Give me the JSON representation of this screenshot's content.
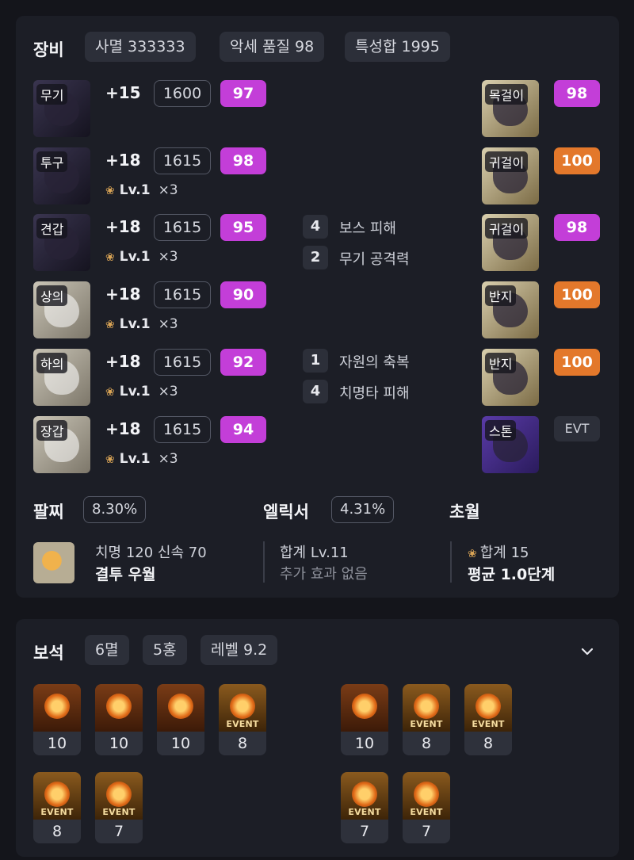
{
  "equipment": {
    "title": "장비",
    "chips": [
      "사멸 333333",
      "악세 품질 98",
      "특성합 1995"
    ],
    "items": [
      {
        "slot": "무기",
        "upgrade": "+15",
        "item_level": "1600",
        "quality": "97",
        "quality_color": "#c33ed8",
        "elixir": null
      },
      {
        "slot": "투구",
        "upgrade": "+18",
        "item_level": "1615",
        "quality": "98",
        "quality_color": "#c33ed8",
        "elixir": {
          "level": "Lv.1",
          "count": "×3"
        }
      },
      {
        "slot": "견갑",
        "upgrade": "+18",
        "item_level": "1615",
        "quality": "95",
        "quality_color": "#c33ed8",
        "elixir": {
          "level": "Lv.1",
          "count": "×3"
        }
      },
      {
        "slot": "상의",
        "upgrade": "+18",
        "item_level": "1615",
        "quality": "90",
        "quality_color": "#c33ed8",
        "elixir": {
          "level": "Lv.1",
          "count": "×3"
        }
      },
      {
        "slot": "하의",
        "upgrade": "+18",
        "item_level": "1615",
        "quality": "92",
        "quality_color": "#c33ed8",
        "elixir": {
          "level": "Lv.1",
          "count": "×3"
        }
      },
      {
        "slot": "장갑",
        "upgrade": "+18",
        "item_level": "1615",
        "quality": "94",
        "quality_color": "#c33ed8",
        "elixir": {
          "level": "Lv.1",
          "count": "×3"
        }
      }
    ],
    "set_effects": [
      {
        "count": "4",
        "name": "보스 피해"
      },
      {
        "count": "2",
        "name": "무기 공격력"
      },
      {
        "count": "1",
        "name": "자원의 축복"
      },
      {
        "count": "4",
        "name": "치명타 피해"
      }
    ],
    "accessories": [
      {
        "slot": "목걸이",
        "quality": "98",
        "quality_color": "#c33ed8"
      },
      {
        "slot": "귀걸이",
        "quality": "100",
        "quality_color": "#e3782b"
      },
      {
        "slot": "귀걸이",
        "quality": "98",
        "quality_color": "#c33ed8"
      },
      {
        "slot": "반지",
        "quality": "100",
        "quality_color": "#e3782b"
      },
      {
        "slot": "반지",
        "quality": "100",
        "quality_color": "#e3782b"
      }
    ],
    "stone": {
      "slot": "스톤",
      "badge": "EVT"
    },
    "bracelet": {
      "title": "팔찌",
      "percent": "8.30%",
      "stats": "치명 120  신속 70",
      "effects": "결투  우월"
    },
    "elixir_summary": {
      "title": "엘릭서",
      "percent": "4.31%",
      "total": "합계 Lv.11",
      "bonus": "추가 효과 없음"
    },
    "transcend": {
      "title": "초월",
      "total": "합계 15",
      "average": "평균 1.0단계"
    },
    "icon_names": {
      "elixir": "lotus-icon"
    }
  },
  "gems": {
    "title": "보석",
    "chips": [
      "6멸",
      "5홍",
      "레벨 9.2"
    ],
    "left": [
      {
        "level": "10",
        "event": false
      },
      {
        "level": "10",
        "event": false
      },
      {
        "level": "10",
        "event": false
      },
      {
        "level": "8",
        "event": true
      },
      {
        "level": "8",
        "event": true
      },
      {
        "level": "7",
        "event": true
      }
    ],
    "right": [
      {
        "level": "10",
        "event": false
      },
      {
        "level": "8",
        "event": true
      },
      {
        "level": "8",
        "event": true
      },
      {
        "level": "7",
        "event": true
      },
      {
        "level": "7",
        "event": true
      }
    ],
    "event_label": "EVENT"
  }
}
